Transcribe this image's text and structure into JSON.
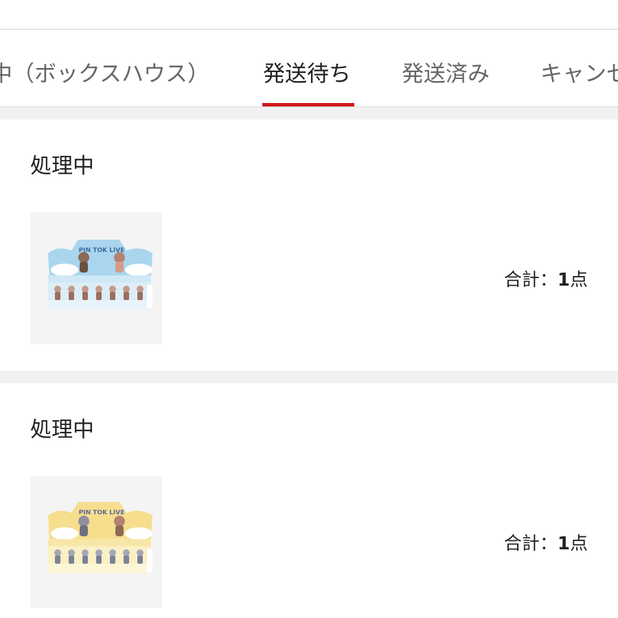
{
  "tabs": [
    {
      "label": "中（ボックスハウス）"
    },
    {
      "label": "発送待ち",
      "active": true
    },
    {
      "label": "発送済み"
    },
    {
      "label": "キャンセ"
    }
  ],
  "accent_color": "#d3161f",
  "orders": [
    {
      "status": "処理中",
      "thumbnail_logo": "PIN TOK LIVE",
      "thumbnail_theme": "blue",
      "total_label": "合計：",
      "total_count": "1",
      "total_unit": "点"
    },
    {
      "status": "処理中",
      "thumbnail_logo": "PIN TOK LIVE",
      "thumbnail_theme": "yellow",
      "total_label": "合計：",
      "total_count": "1",
      "total_unit": "点"
    }
  ]
}
